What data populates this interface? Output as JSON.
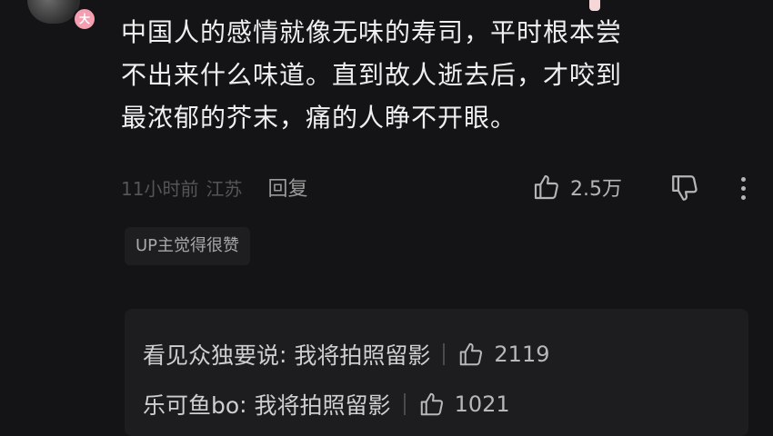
{
  "comment": {
    "avatar_badge": "大",
    "lines": [
      "中国人的感情就像无味的寿司，平时根本尝",
      "不出来什么味道。直到故人逝去后，才咬到",
      "最浓郁的芥末，痛的人睁不开眼。"
    ],
    "time": "11小时前",
    "location": "江苏",
    "reply_label": "回复",
    "like_count": "2.5万",
    "up_tag": "UP主觉得很赞"
  },
  "replies": [
    {
      "author": "看见众独要说",
      "text": "我将拍照留影",
      "likes": "2119"
    },
    {
      "author": "乐可鱼bo",
      "text": "我将拍照留影",
      "likes": "1021"
    }
  ],
  "icons": {
    "like": "thumbs-up-icon",
    "dislike": "thumbs-down-icon",
    "more": "more-vertical-icon"
  }
}
